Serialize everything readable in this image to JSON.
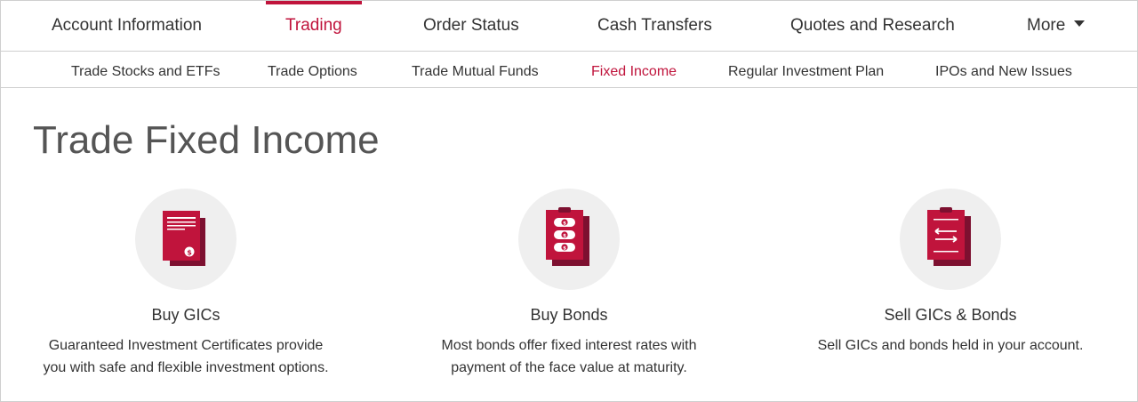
{
  "primary_nav": {
    "items": [
      {
        "label": "Account Information",
        "active": false
      },
      {
        "label": "Trading",
        "active": true
      },
      {
        "label": "Order Status",
        "active": false
      },
      {
        "label": "Cash Transfers",
        "active": false
      },
      {
        "label": "Quotes and Research",
        "active": false
      },
      {
        "label": "More",
        "active": false,
        "icon": "chevron-down-icon"
      }
    ]
  },
  "secondary_nav": {
    "items": [
      {
        "label": "Trade Stocks and ETFs",
        "active": false
      },
      {
        "label": "Trade Options",
        "active": false
      },
      {
        "label": "Trade Mutual Funds",
        "active": false
      },
      {
        "label": "Fixed Income",
        "active": true
      },
      {
        "label": "Regular Investment Plan",
        "active": false
      },
      {
        "label": "IPOs and New Issues",
        "active": false
      }
    ]
  },
  "main": {
    "title": "Trade Fixed Income",
    "cards": [
      {
        "icon": "gic-document-icon",
        "title": "Buy GICs",
        "desc_line1": "Guaranteed Investment Certificates provide",
        "desc_line2": "you with safe and flexible investment options."
      },
      {
        "icon": "bonds-clipboard-icon",
        "title": "Buy Bonds",
        "desc_line1": "Most bonds offer fixed interest rates with",
        "desc_line2": "payment of the face value at maturity."
      },
      {
        "icon": "sell-clipboard-icon",
        "title": "Sell GICs & Bonds",
        "desc_line1": "Sell GICs and bonds held in your account.",
        "desc_line2": ""
      }
    ]
  },
  "colors": {
    "accent": "#c0143c",
    "accent_dark": "#7d1030",
    "icon_bg": "#efefef",
    "text": "#333333",
    "title_text": "#555555",
    "border": "#cfcfcf"
  }
}
